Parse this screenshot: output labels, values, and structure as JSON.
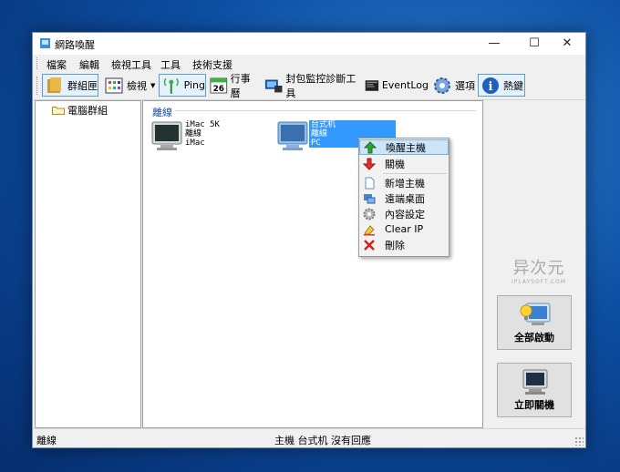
{
  "window": {
    "title": "網路喚醒"
  },
  "menu": [
    "檔案",
    "編輯",
    "檢視工具",
    "工具",
    "技術支援"
  ],
  "toolbar": {
    "group": "群組匣",
    "view": "檢視",
    "ping": "Ping",
    "calendar": "行事曆",
    "calendar_day": "26",
    "packet": "封包監控診斷工具",
    "eventlog": "EventLog",
    "options": "選項",
    "hotkeys": "熱鍵"
  },
  "tree": {
    "root": "電腦群組"
  },
  "group": {
    "label": "離線"
  },
  "hosts": [
    {
      "name": "iMac 5K",
      "status": "離線",
      "os": "iMac",
      "selected": false
    },
    {
      "name": "台式机",
      "status": "離線",
      "os": "PC",
      "selected": true
    }
  ],
  "context_menu": {
    "items": [
      {
        "label": "喚醒主機",
        "icon": "wake-up-arrow-icon"
      },
      {
        "label": "關機",
        "icon": "shutdown-arrow-icon"
      },
      {
        "label": "新增主機",
        "icon": "new-host-icon"
      },
      {
        "label": "遠端桌面",
        "icon": "remote-desktop-icon"
      },
      {
        "label": "內容設定",
        "icon": "settings-gear-icon"
      },
      {
        "label": "Clear IP",
        "icon": "clear-ip-icon"
      },
      {
        "label": "刪除",
        "icon": "delete-x-icon"
      }
    ]
  },
  "right_panel": {
    "brand_cn": "异次元",
    "brand_en": "IPLAYSOFT.COM",
    "wake_all": "全部啟動",
    "shutdown_now": "立即關機"
  },
  "statusbar": {
    "left": "離線",
    "center": "主機 台式机 沒有回應"
  },
  "colors": {
    "accent": "#3399ff",
    "selection": "#3399ff",
    "context_active": "#cce4f7"
  }
}
